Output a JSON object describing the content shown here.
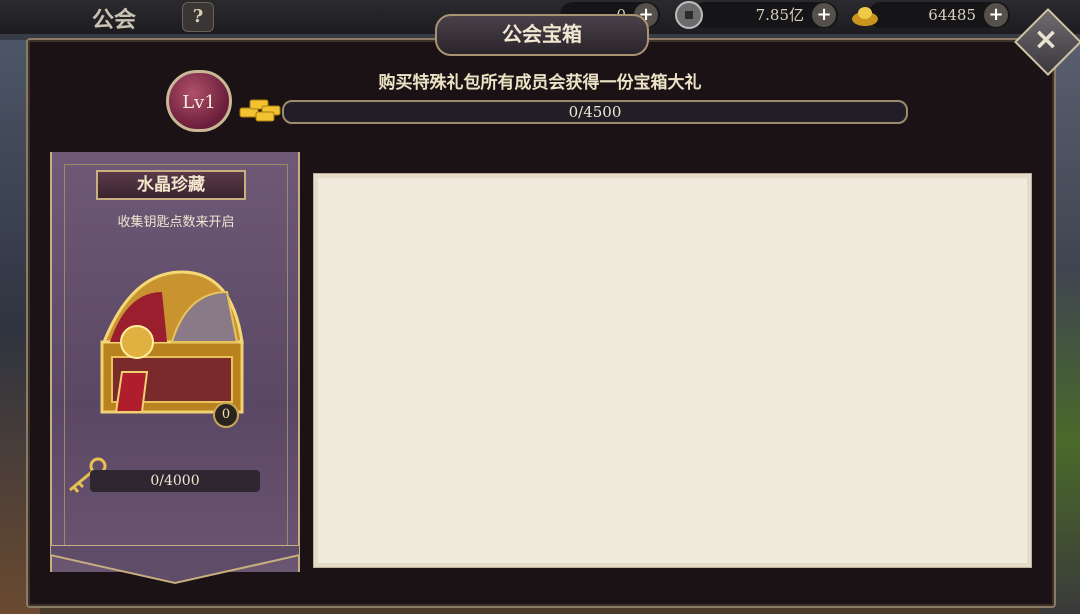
{
  "topbar": {
    "title": "公会",
    "help_label": "?",
    "resources": [
      {
        "icon": "currency-icon",
        "value": "0"
      },
      {
        "icon": "coin-icon",
        "value": "7.85亿"
      },
      {
        "icon": "ingot-icon",
        "value": "64485"
      }
    ],
    "plus_label": "+"
  },
  "dialog": {
    "title": "公会宝箱",
    "close_label": "×",
    "level": "Lv1",
    "notice": "购买特殊礼包所有成员会获得一份宝箱大礼",
    "guild_progress": {
      "text": "0/4500",
      "current": 0,
      "max": 4500
    }
  },
  "banner": {
    "title": "水晶珍藏",
    "subtitle": "收集钥匙点数来开启",
    "chest_count": "0",
    "key_progress": {
      "text": "0/4000",
      "current": 0,
      "max": 4000
    }
  },
  "colors": {
    "accent": "#c8a858",
    "panel": "#efeadc",
    "banner": "#5a4763"
  }
}
